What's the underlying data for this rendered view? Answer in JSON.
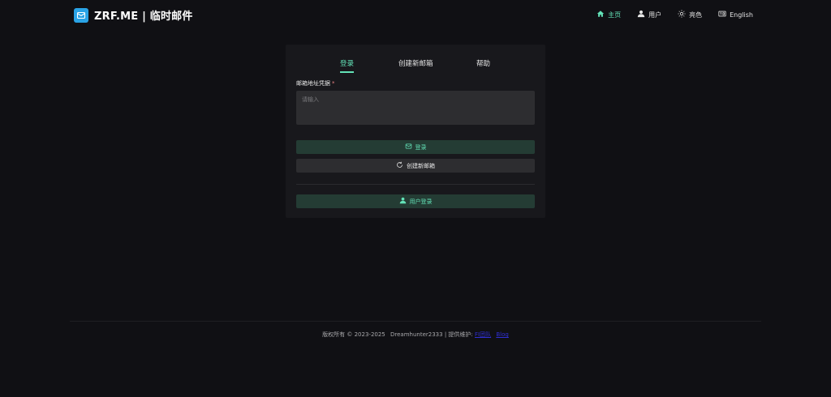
{
  "header": {
    "logo_text": "ZRF.ME | 临时邮件",
    "nav": [
      {
        "label": "主页",
        "icon": "home-icon",
        "active": true
      },
      {
        "label": "用户",
        "icon": "user-icon",
        "active": false
      },
      {
        "label": "亮色",
        "icon": "sun-icon",
        "active": false
      },
      {
        "label": "English",
        "icon": "language-icon",
        "active": false
      }
    ]
  },
  "tabs": [
    {
      "label": "登录",
      "active": true
    },
    {
      "label": "创建新邮箱",
      "active": false
    },
    {
      "label": "帮助",
      "active": false
    }
  ],
  "form": {
    "label": "邮箱地址凭据",
    "required_mark": "*",
    "placeholder": "请输入",
    "value": ""
  },
  "buttons": {
    "login": "登录",
    "create": "创建新邮箱",
    "user_login": "用户登录"
  },
  "footer": {
    "copyright": "版权所有 © 2023-2025",
    "dev_prefix": "Dreamhunter2333",
    "maintainer_prefix": "| 提供维护:",
    "maintainer_link": "FI团队",
    "blog_link": "Blog"
  },
  "colors": {
    "background": "#101014",
    "card": "#18181c",
    "accent": "#63e2b7",
    "logo": "#2aa3e6"
  }
}
